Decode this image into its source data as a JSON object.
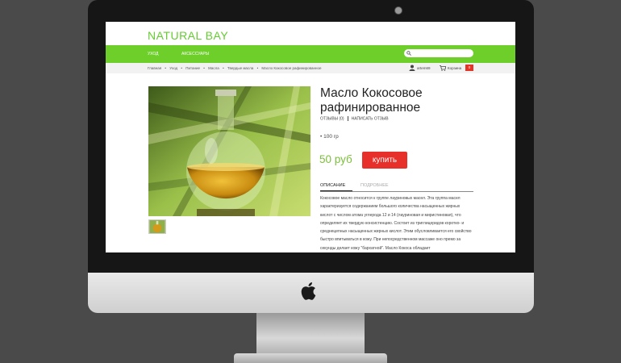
{
  "site": {
    "logo": "NATURAL BAY",
    "brand_color": "#6ecf2a",
    "nav": [
      "УХОД",
      "АКСЕССУАРЫ"
    ],
    "search": {
      "placeholder": ""
    }
  },
  "breadcrumb": [
    "Главная",
    "•",
    "Уход",
    "•",
    "Питание",
    "•",
    "Масла",
    "•",
    "Твердые масла",
    "•",
    "Масло Кокосовое рафинированное"
  ],
  "account": {
    "user": "artem69",
    "cart_label": "Корзина",
    "cart_count": "0"
  },
  "product": {
    "title": "Масло Кокосовое рафинированное",
    "reviews": "ОТЗЫВЫ (0)",
    "write_review": "НАПИСАТЬ ОТЗЫВ",
    "variant": "100 гр",
    "price": "50 руб",
    "buy": "купить",
    "tabs": [
      "ОПИСАНИЕ",
      "ПОДРОБНЕЕ"
    ],
    "description": "Кокосовое масло относится к группе лауриновых масел. Эта группа масел характеризуется содержанием большого количества насыщенных жирных кислот с числом атома углерода 12 и 14 (лауриновая и миристиновая), что определяет их твердую консистенцию. Состоит из триглицеридов коротко- и среднецепных насыщенных жирных кислот. Этим обусловливается его свойство быстро впитываться в кожу. При непосредственном массаже оно премо за секунды делает кожу \"бархатной\". Масло Кокоса обладает"
  },
  "colors": {
    "price": "#7cbf3c",
    "buy_button": "#e8302a"
  }
}
